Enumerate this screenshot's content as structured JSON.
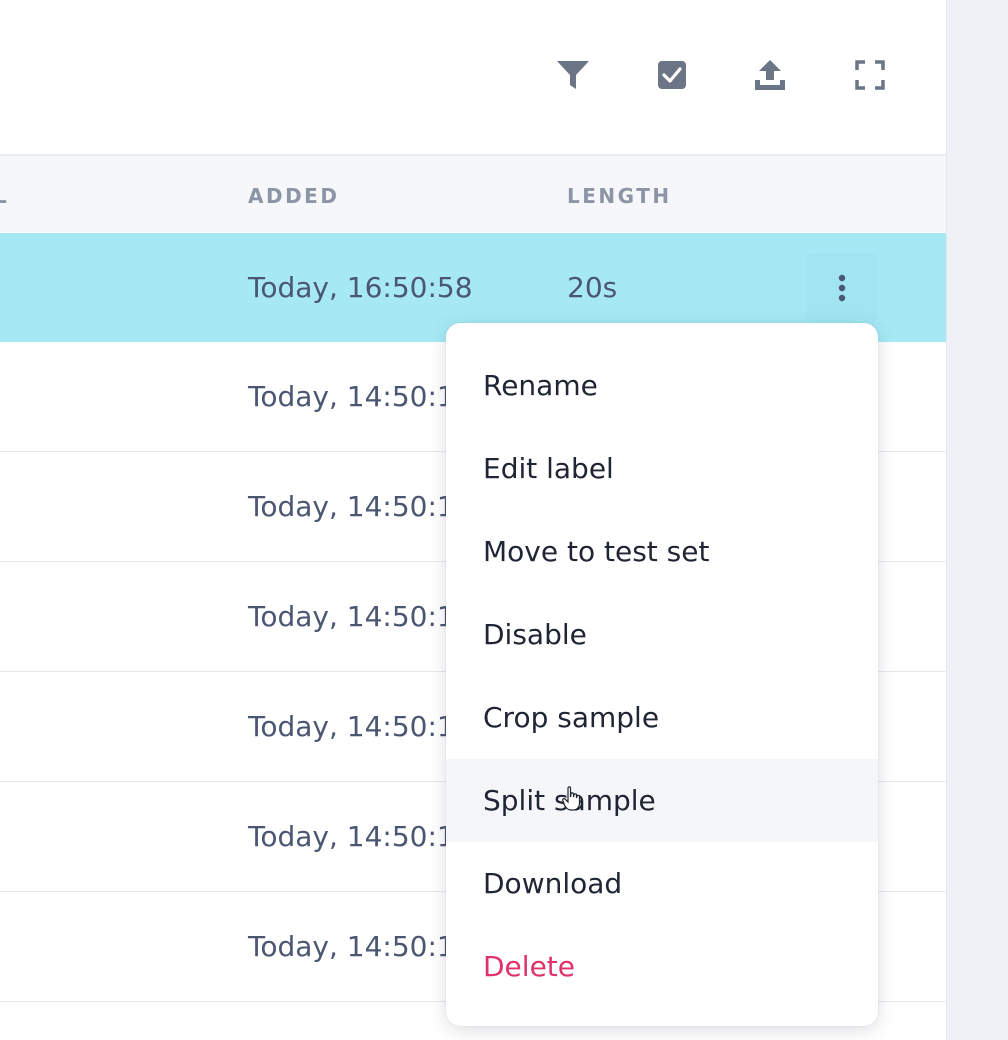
{
  "toolbar": {
    "icons": [
      "filter-icon",
      "checkbox-icon",
      "upload-icon",
      "fullscreen-icon"
    ]
  },
  "table": {
    "columns": {
      "label": "L",
      "added": "ADDED",
      "length": "LENGTH"
    },
    "rows": [
      {
        "added": "Today, 16:50:58",
        "length": "20s",
        "selected": true
      },
      {
        "added": "Today, 14:50:1",
        "length": ""
      },
      {
        "added": "Today, 14:50:1",
        "length": ""
      },
      {
        "added": "Today, 14:50:1",
        "length": ""
      },
      {
        "added": "Today, 14:50:1",
        "length": ""
      },
      {
        "added": "Today, 14:50:1",
        "length": ""
      },
      {
        "added": "Today, 14:50:1",
        "length": ""
      }
    ]
  },
  "context_menu": {
    "items": [
      {
        "label": "Rename"
      },
      {
        "label": "Edit label"
      },
      {
        "label": "Move to test set"
      },
      {
        "label": "Disable"
      },
      {
        "label": "Crop sample"
      },
      {
        "label": "Split sample",
        "hovered": true
      },
      {
        "label": "Download"
      },
      {
        "label": "Delete",
        "danger": true
      }
    ]
  },
  "colors": {
    "selected_row": "#a6e9f5",
    "danger": "#e0336a",
    "icon": "#6b7585"
  }
}
